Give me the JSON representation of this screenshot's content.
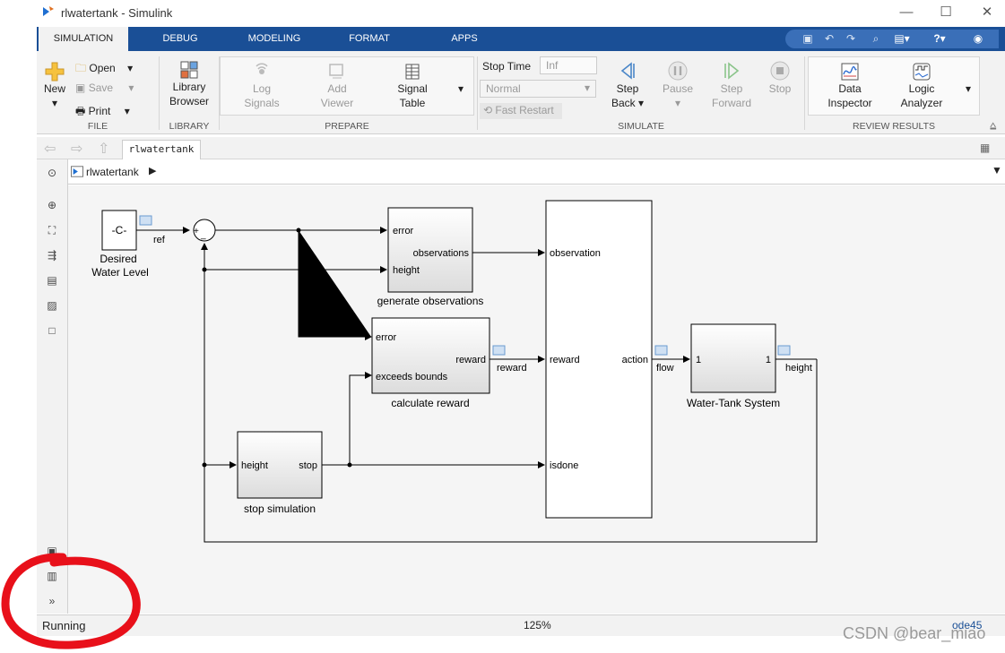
{
  "window": {
    "title": "rlwatertank - Simulink",
    "minimize": "—",
    "maximize": "☐",
    "close": "✕"
  },
  "tabs": [
    {
      "label": "SIMULATION",
      "active": true
    },
    {
      "label": "DEBUG"
    },
    {
      "label": "MODELING"
    },
    {
      "label": "FORMAT"
    },
    {
      "label": "APPS"
    }
  ],
  "ribbon": {
    "file": {
      "new": "New",
      "open": "Open",
      "save": "Save",
      "print": "Print",
      "section": "FILE"
    },
    "library": {
      "label_1": "Library",
      "label_2": "Browser",
      "section": "LIBRARY"
    },
    "prepare": {
      "log_1": "Log",
      "log_2": "Signals",
      "add_1": "Add",
      "add_2": "Viewer",
      "signal_1": "Signal",
      "signal_2": "Table",
      "section": "PREPARE"
    },
    "simulate": {
      "stop_time_label": "Stop Time",
      "stop_time_value": "Inf",
      "mode": "Normal",
      "fast_restart": "Fast Restart",
      "step_back_1": "Step",
      "step_back_2": "Back",
      "pause": "Pause",
      "step_fwd_1": "Step",
      "step_fwd_2": "Forward",
      "stop": "Stop",
      "section": "SIMULATE"
    },
    "review": {
      "di_1": "Data",
      "di_2": "Inspector",
      "la_1": "Logic",
      "la_2": "Analyzer",
      "section": "REVIEW RESULTS"
    }
  },
  "doc_tab": "rlwatertank",
  "breadcrumb": "rlwatertank",
  "diagram": {
    "const_value": "-C-",
    "const_name_1": "Desired",
    "const_name_2": "Water Level",
    "ref": "ref",
    "sum_plus": "+",
    "sum_minus": "_",
    "gen_obs": {
      "in1": "error",
      "out": "observations",
      "in2": "height",
      "name": "generate observations"
    },
    "calc_rew": {
      "in1": "error",
      "out": "reward",
      "in2": "exceeds bounds",
      "name": "calculate reward"
    },
    "stop_sim": {
      "in": "height",
      "out": "stop",
      "name": "stop simulation"
    },
    "agent": {
      "in1": "observation",
      "in2": "reward",
      "in3": "isdone",
      "out": "action"
    },
    "tank": {
      "in": "1",
      "out": "1",
      "name": "Water-Tank System"
    },
    "signals": {
      "reward": "reward",
      "flow": "flow",
      "height": "height"
    }
  },
  "status": {
    "state": "Running",
    "zoom": "125%",
    "solver": "ode45"
  },
  "watermark": "CSDN @bear_miao",
  "colors": {
    "tab_blue": "#1a4f96",
    "annotation_red": "#e8101a"
  }
}
